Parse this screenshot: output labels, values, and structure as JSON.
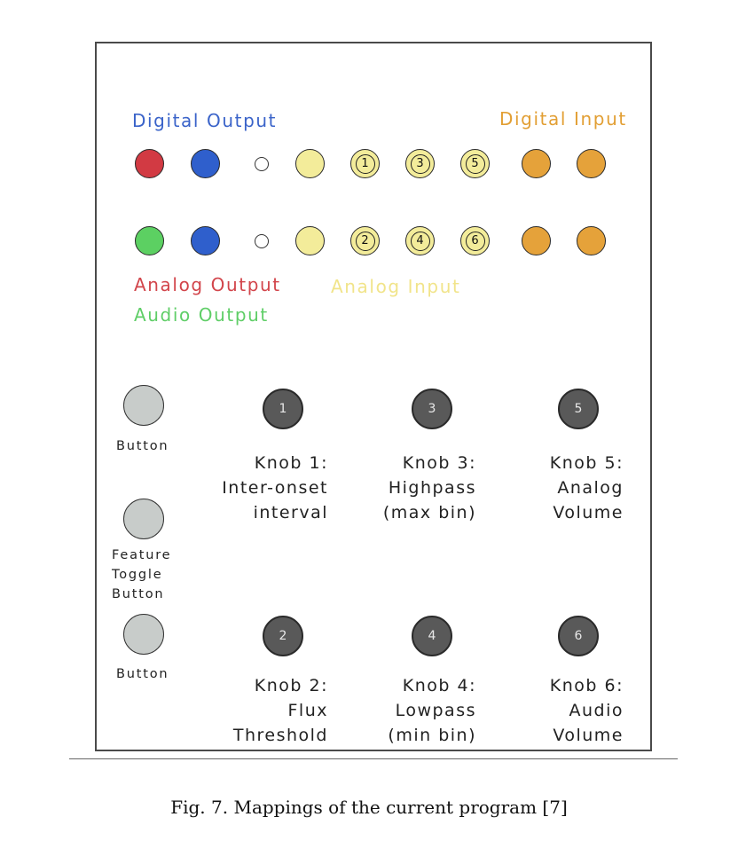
{
  "labels": {
    "digital_output": "Digital Output",
    "digital_input": "Digital Input",
    "analog_output": "Analog Output",
    "analog_input": "Analog Input",
    "audio_output": "Audio Output"
  },
  "colors": {
    "digital_output": "#3a63c9",
    "digital_input": "#e29f34",
    "analog_output": "#d2454b",
    "analog_input": "#f1e48a",
    "audio_output": "#5fce67",
    "jack_red": "#d23a43",
    "jack_blue": "#2f5fcc",
    "jack_green": "#5cd062",
    "jack_yellow": "#f3ec9a",
    "jack_orange": "#e5a23a",
    "knob": "#595959",
    "button": "#c8ccca"
  },
  "jacks": {
    "row1_numbers": [
      "1",
      "3",
      "5"
    ],
    "row2_numbers": [
      "2",
      "4",
      "6"
    ]
  },
  "knobs": [
    {
      "number": "1",
      "lines": [
        "Knob 1:",
        "Inter-onset",
        "interval"
      ]
    },
    {
      "number": "3",
      "lines": [
        "Knob 3:",
        "Highpass",
        "(max bin)"
      ]
    },
    {
      "number": "5",
      "lines": [
        "Knob 5:",
        "Analog",
        "Volume"
      ]
    },
    {
      "number": "2",
      "lines": [
        "Knob 2:",
        "Flux",
        "Threshold"
      ]
    },
    {
      "number": "4",
      "lines": [
        "Knob 4:",
        "Lowpass",
        "(min bin)"
      ]
    },
    {
      "number": "6",
      "lines": [
        "Knob 6:",
        "Audio",
        "Volume"
      ]
    }
  ],
  "buttons": [
    {
      "lines": [
        "Button"
      ]
    },
    {
      "lines": [
        "Feature",
        "Toggle",
        "Button"
      ]
    },
    {
      "lines": [
        "Button"
      ]
    }
  ],
  "caption": "Fig. 7.  Mappings of the current program [7]"
}
